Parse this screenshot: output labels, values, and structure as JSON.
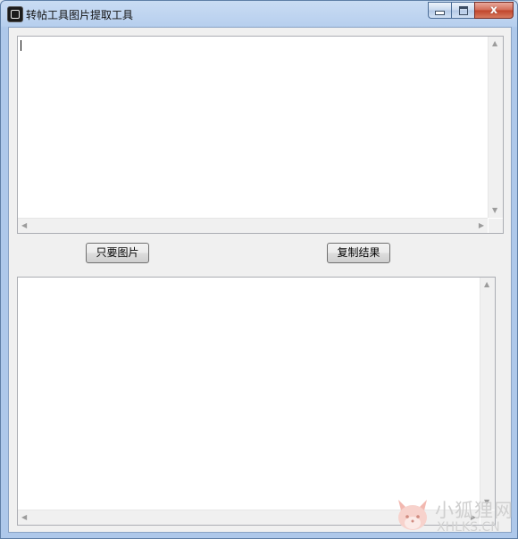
{
  "window": {
    "title": "转帖工具图片提取工具",
    "controls": [
      "minimize",
      "maximize",
      "close"
    ],
    "close_glyph": "x"
  },
  "input_area": {
    "value": ""
  },
  "buttons": {
    "only_images": "只要图片",
    "copy_result": "复制结果"
  },
  "output_area": {
    "value": ""
  },
  "watermark": {
    "cn": "小狐狸网",
    "en": "XHLKS.CN"
  },
  "icons": {
    "app": "app-icon",
    "scroll_up": "▲",
    "scroll_down": "▼",
    "scroll_left": "◀",
    "scroll_right": "▶"
  },
  "colors": {
    "frame": "#aec8ea",
    "client": "#f0f0f0",
    "close_button": "#c0442b"
  }
}
